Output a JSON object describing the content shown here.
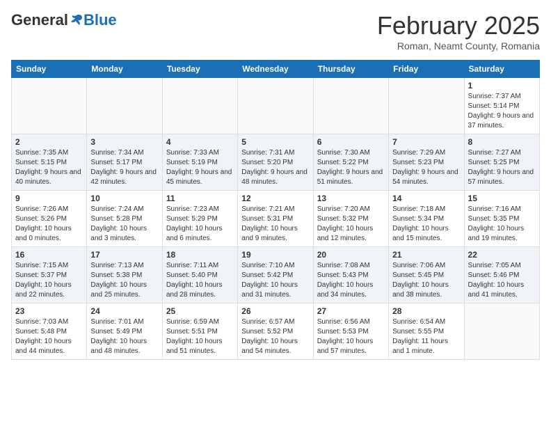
{
  "logo": {
    "general": "General",
    "blue": "Blue"
  },
  "title": "February 2025",
  "subtitle": "Roman, Neamt County, Romania",
  "days_header": [
    "Sunday",
    "Monday",
    "Tuesday",
    "Wednesday",
    "Thursday",
    "Friday",
    "Saturday"
  ],
  "weeks": [
    [
      {
        "day": "",
        "info": ""
      },
      {
        "day": "",
        "info": ""
      },
      {
        "day": "",
        "info": ""
      },
      {
        "day": "",
        "info": ""
      },
      {
        "day": "",
        "info": ""
      },
      {
        "day": "",
        "info": ""
      },
      {
        "day": "1",
        "info": "Sunrise: 7:37 AM\nSunset: 5:14 PM\nDaylight: 9 hours and 37 minutes."
      }
    ],
    [
      {
        "day": "2",
        "info": "Sunrise: 7:35 AM\nSunset: 5:15 PM\nDaylight: 9 hours and 40 minutes."
      },
      {
        "day": "3",
        "info": "Sunrise: 7:34 AM\nSunset: 5:17 PM\nDaylight: 9 hours and 42 minutes."
      },
      {
        "day": "4",
        "info": "Sunrise: 7:33 AM\nSunset: 5:19 PM\nDaylight: 9 hours and 45 minutes."
      },
      {
        "day": "5",
        "info": "Sunrise: 7:31 AM\nSunset: 5:20 PM\nDaylight: 9 hours and 48 minutes."
      },
      {
        "day": "6",
        "info": "Sunrise: 7:30 AM\nSunset: 5:22 PM\nDaylight: 9 hours and 51 minutes."
      },
      {
        "day": "7",
        "info": "Sunrise: 7:29 AM\nSunset: 5:23 PM\nDaylight: 9 hours and 54 minutes."
      },
      {
        "day": "8",
        "info": "Sunrise: 7:27 AM\nSunset: 5:25 PM\nDaylight: 9 hours and 57 minutes."
      }
    ],
    [
      {
        "day": "9",
        "info": "Sunrise: 7:26 AM\nSunset: 5:26 PM\nDaylight: 10 hours and 0 minutes."
      },
      {
        "day": "10",
        "info": "Sunrise: 7:24 AM\nSunset: 5:28 PM\nDaylight: 10 hours and 3 minutes."
      },
      {
        "day": "11",
        "info": "Sunrise: 7:23 AM\nSunset: 5:29 PM\nDaylight: 10 hours and 6 minutes."
      },
      {
        "day": "12",
        "info": "Sunrise: 7:21 AM\nSunset: 5:31 PM\nDaylight: 10 hours and 9 minutes."
      },
      {
        "day": "13",
        "info": "Sunrise: 7:20 AM\nSunset: 5:32 PM\nDaylight: 10 hours and 12 minutes."
      },
      {
        "day": "14",
        "info": "Sunrise: 7:18 AM\nSunset: 5:34 PM\nDaylight: 10 hours and 15 minutes."
      },
      {
        "day": "15",
        "info": "Sunrise: 7:16 AM\nSunset: 5:35 PM\nDaylight: 10 hours and 19 minutes."
      }
    ],
    [
      {
        "day": "16",
        "info": "Sunrise: 7:15 AM\nSunset: 5:37 PM\nDaylight: 10 hours and 22 minutes."
      },
      {
        "day": "17",
        "info": "Sunrise: 7:13 AM\nSunset: 5:38 PM\nDaylight: 10 hours and 25 minutes."
      },
      {
        "day": "18",
        "info": "Sunrise: 7:11 AM\nSunset: 5:40 PM\nDaylight: 10 hours and 28 minutes."
      },
      {
        "day": "19",
        "info": "Sunrise: 7:10 AM\nSunset: 5:42 PM\nDaylight: 10 hours and 31 minutes."
      },
      {
        "day": "20",
        "info": "Sunrise: 7:08 AM\nSunset: 5:43 PM\nDaylight: 10 hours and 34 minutes."
      },
      {
        "day": "21",
        "info": "Sunrise: 7:06 AM\nSunset: 5:45 PM\nDaylight: 10 hours and 38 minutes."
      },
      {
        "day": "22",
        "info": "Sunrise: 7:05 AM\nSunset: 5:46 PM\nDaylight: 10 hours and 41 minutes."
      }
    ],
    [
      {
        "day": "23",
        "info": "Sunrise: 7:03 AM\nSunset: 5:48 PM\nDaylight: 10 hours and 44 minutes."
      },
      {
        "day": "24",
        "info": "Sunrise: 7:01 AM\nSunset: 5:49 PM\nDaylight: 10 hours and 48 minutes."
      },
      {
        "day": "25",
        "info": "Sunrise: 6:59 AM\nSunset: 5:51 PM\nDaylight: 10 hours and 51 minutes."
      },
      {
        "day": "26",
        "info": "Sunrise: 6:57 AM\nSunset: 5:52 PM\nDaylight: 10 hours and 54 minutes."
      },
      {
        "day": "27",
        "info": "Sunrise: 6:56 AM\nSunset: 5:53 PM\nDaylight: 10 hours and 57 minutes."
      },
      {
        "day": "28",
        "info": "Sunrise: 6:54 AM\nSunset: 5:55 PM\nDaylight: 11 hours and 1 minute."
      },
      {
        "day": "",
        "info": ""
      }
    ]
  ]
}
